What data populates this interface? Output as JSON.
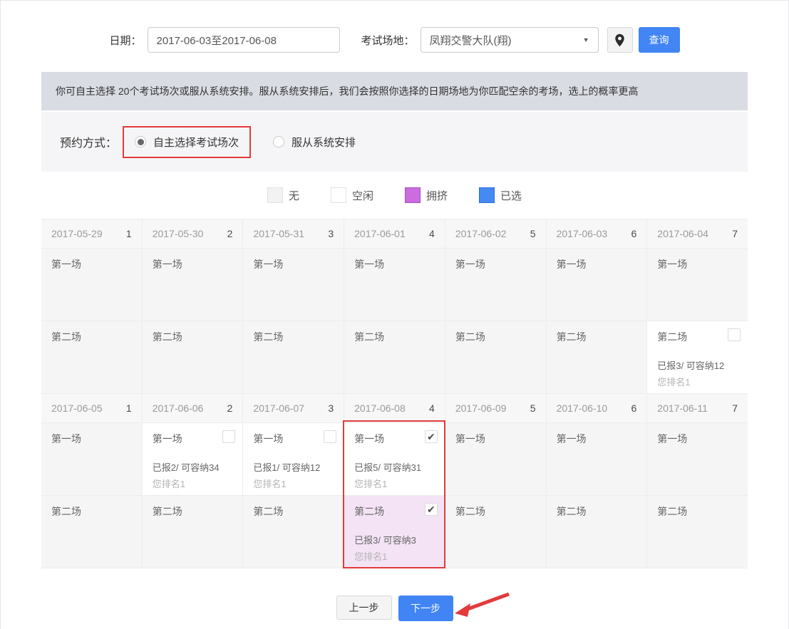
{
  "filters": {
    "date_label": "日期：",
    "date_value": "2017-06-03至2017-06-08",
    "venue_label": "考试场地：",
    "venue_value": "凤翔交警大队(翔)",
    "query_button": "查询"
  },
  "notice": "你可自主选择 20个考试场次或服从系统安排。服从系统安排后，我们会按照你选择的日期场地为你匹配空余的考场，选上的概率更高",
  "booking": {
    "label": "预约方式：",
    "options": [
      {
        "label": "自主选择考试场次",
        "selected": true,
        "highlighted_red_box": true
      },
      {
        "label": "服从系统安排",
        "selected": false
      }
    ]
  },
  "legend": [
    {
      "label": "无",
      "color": "#f2f2f2",
      "border": "#e3e3e3"
    },
    {
      "label": "空闲",
      "color": "#ffffff",
      "border": "#e3e3e3"
    },
    {
      "label": "拥挤",
      "color": "#cb6ce0",
      "border": "#a24fb5"
    },
    {
      "label": "已选",
      "color": "#4589f2",
      "border": "#2a6fdb"
    }
  ],
  "colors": {
    "accent_red": "#e23b3c",
    "primary_blue": "#4285f4",
    "crowded_cell": "#f3e3f5",
    "empty_cell": "#f5f5f5",
    "notice_bar": "#d9dce3"
  },
  "calendar": {
    "session1_label": "第一场",
    "session2_label": "第二场",
    "check_glyph": "✔",
    "weeks": [
      {
        "days": [
          {
            "date": "2017-05-29",
            "num": "1",
            "sessions": [
              {
                "status": "none"
              },
              {
                "status": "none"
              }
            ]
          },
          {
            "date": "2017-05-30",
            "num": "2",
            "sessions": [
              {
                "status": "none"
              },
              {
                "status": "none"
              }
            ]
          },
          {
            "date": "2017-05-31",
            "num": "3",
            "sessions": [
              {
                "status": "none"
              },
              {
                "status": "none"
              }
            ]
          },
          {
            "date": "2017-06-01",
            "num": "4",
            "sessions": [
              {
                "status": "none"
              },
              {
                "status": "none"
              }
            ]
          },
          {
            "date": "2017-06-02",
            "num": "5",
            "sessions": [
              {
                "status": "none"
              },
              {
                "status": "none"
              }
            ]
          },
          {
            "date": "2017-06-03",
            "num": "6",
            "sessions": [
              {
                "status": "none"
              },
              {
                "status": "none"
              }
            ]
          },
          {
            "date": "2017-06-04",
            "num": "7",
            "sessions": [
              {
                "status": "none"
              },
              {
                "status": "free",
                "checkbox": "unchecked",
                "stats": "已报3/ 可容纳12",
                "rank": "您排名1"
              }
            ]
          }
        ]
      },
      {
        "days": [
          {
            "date": "2017-06-05",
            "num": "1",
            "sessions": [
              {
                "status": "none"
              },
              {
                "status": "none"
              }
            ]
          },
          {
            "date": "2017-06-06",
            "num": "2",
            "sessions": [
              {
                "status": "free",
                "checkbox": "unchecked",
                "stats": "已报2/ 可容纳34",
                "rank": "您排名1"
              },
              {
                "status": "none"
              }
            ]
          },
          {
            "date": "2017-06-07",
            "num": "3",
            "sessions": [
              {
                "status": "free",
                "checkbox": "unchecked",
                "stats": "已报1/ 可容纳12",
                "rank": "您排名1"
              },
              {
                "status": "none"
              }
            ]
          },
          {
            "date": "2017-06-08",
            "num": "4",
            "sessions": [
              {
                "status": "free",
                "checkbox": "checked",
                "stats": "已报5/ 可容纳31",
                "rank": "您排名1"
              },
              {
                "status": "crowded",
                "checkbox": "checked",
                "stats": "已报3/ 可容纳3",
                "rank": "您排名1"
              }
            ],
            "highlighted_red_box": true
          },
          {
            "date": "2017-06-09",
            "num": "5",
            "sessions": [
              {
                "status": "none"
              },
              {
                "status": "none"
              }
            ]
          },
          {
            "date": "2017-06-10",
            "num": "6",
            "sessions": [
              {
                "status": "none"
              },
              {
                "status": "none"
              }
            ]
          },
          {
            "date": "2017-06-11",
            "num": "7",
            "sessions": [
              {
                "status": "none"
              },
              {
                "status": "none"
              }
            ]
          }
        ]
      }
    ]
  },
  "footer": {
    "prev_label": "上一步",
    "next_label": "下一步"
  }
}
